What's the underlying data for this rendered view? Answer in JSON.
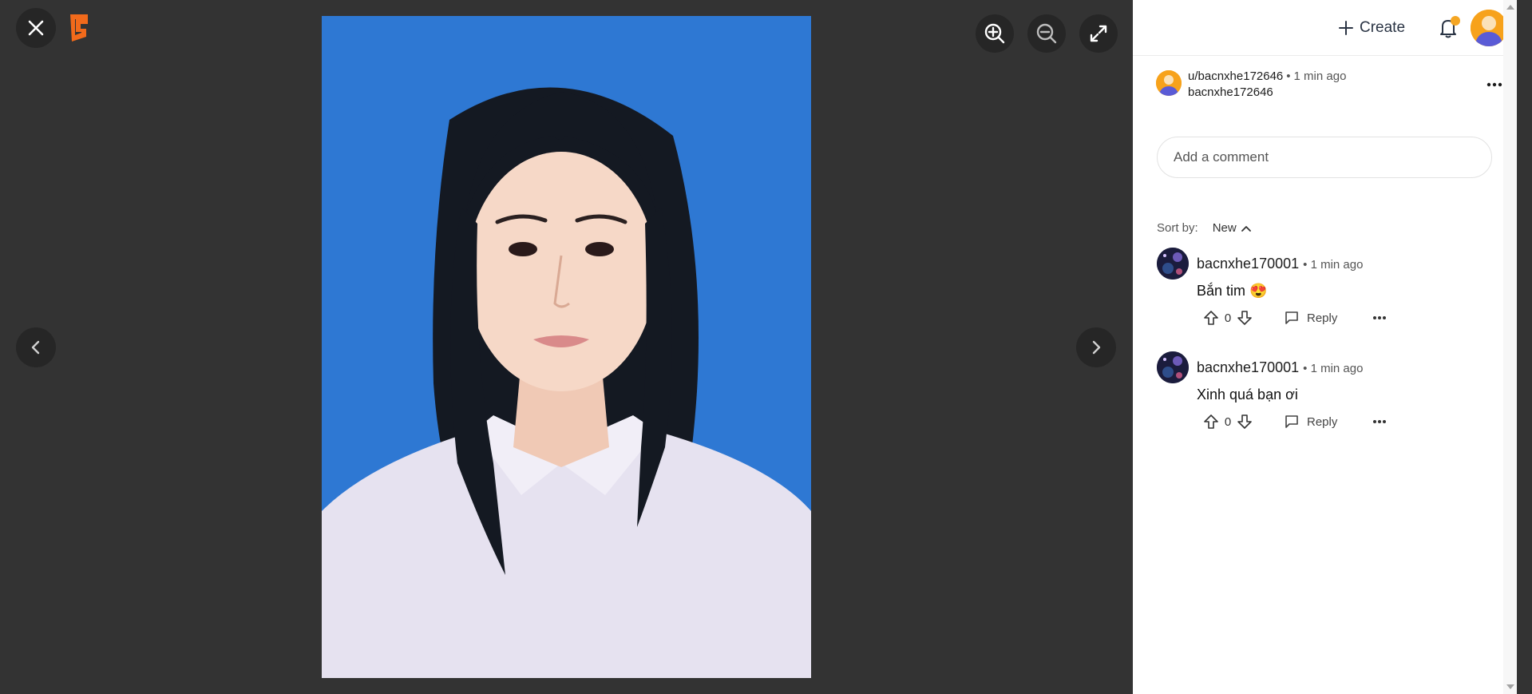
{
  "viewer": {
    "photo_alt": "ID portrait photo",
    "background_color": "#2e78d3",
    "icons": {
      "close": "close-icon",
      "logo": "logo-icon",
      "zoom_in": "zoom-in-icon",
      "zoom_out": "zoom-out-icon",
      "fullscreen": "expand-icon",
      "prev": "chevron-left-icon",
      "next": "chevron-right-icon"
    }
  },
  "header": {
    "create_label": "Create",
    "notification_badge_color": "#f5a623"
  },
  "post": {
    "user": "u/bacnxhe172646",
    "time": "1 min ago",
    "display_name": "bacnxhe172646"
  },
  "comment_input": {
    "placeholder": "Add a comment"
  },
  "sort": {
    "label": "Sort by:",
    "value": "New"
  },
  "comments": [
    {
      "user": "bacnxhe170001",
      "time": "1 min ago",
      "text": "Bắn tim 😍",
      "votes": "0",
      "reply_label": "Reply"
    },
    {
      "user": "bacnxhe170001",
      "time": "1 min ago",
      "text": "Xinh quá bạn ơi",
      "votes": "0",
      "reply_label": "Reply"
    }
  ],
  "colors": {
    "accent_orange": "#f7a21b",
    "logo_orange": "#f26a1b",
    "viewer_bg": "#333333"
  }
}
